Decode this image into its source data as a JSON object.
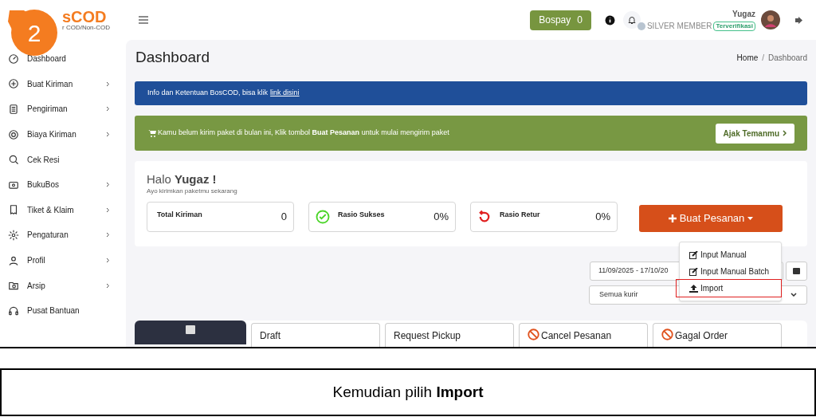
{
  "step_badge": "2",
  "logo": {
    "text": "sCOD",
    "tagline": "r COD/Non-COD"
  },
  "header": {
    "bospay": {
      "label": "Bospay",
      "value": "0"
    },
    "user": {
      "name": "Yugaz",
      "member": "SILVER MEMBER",
      "status": "Terverifikasi"
    }
  },
  "sidebar": {
    "items": [
      {
        "label": "Dashboard",
        "has_submenu": false
      },
      {
        "label": "Buat Kiriman",
        "has_submenu": true
      },
      {
        "label": "Pengiriman",
        "has_submenu": true
      },
      {
        "label": "Biaya Kiriman",
        "has_submenu": true
      },
      {
        "label": "Cek Resi",
        "has_submenu": false
      },
      {
        "label": "BukuBos",
        "has_submenu": true
      },
      {
        "label": "Tiket & Klaim",
        "has_submenu": true
      },
      {
        "label": "Pengaturan",
        "has_submenu": true
      },
      {
        "label": "Profil",
        "has_submenu": true
      },
      {
        "label": "Arsip",
        "has_submenu": true
      },
      {
        "label": "Pusat Bantuan",
        "has_submenu": false
      }
    ]
  },
  "page": {
    "title": "Dashboard",
    "breadcrumb": [
      "Home",
      "Dashboard"
    ],
    "breadcrumb_separator": "/"
  },
  "info_banner": {
    "text": "Info dan Ketentuan BosCOD, bisa klik",
    "link": "link disini"
  },
  "promo_banner": {
    "text": "Kamu belum kirim paket di bulan ini, Klik tombol **Buat Pesanan** untuk mulai mengirim paket",
    "button": "Ajak Temanmu"
  },
  "greeting": {
    "hello": "Halo",
    "name": "Yugaz !",
    "subtitle": "Ayo kirimkan paketmu sekarang"
  },
  "stats": [
    {
      "kind": "plain",
      "label": "Total Kiriman",
      "value": "0"
    },
    {
      "kind": "success",
      "label": "Rasio Sukses",
      "value": "0%"
    },
    {
      "kind": "return",
      "label": "Rasio Retur",
      "value": "0%"
    }
  ],
  "create_button": {
    "label": "Buat Pesanan",
    "items": [
      {
        "kind": "edit",
        "label": "Input Manual",
        "highlighted": false
      },
      {
        "kind": "edit",
        "label": "Input Manual Batch",
        "highlighted": false
      },
      {
        "kind": "upload",
        "label": "Import",
        "highlighted": true
      }
    ]
  },
  "filters": {
    "date_range": "11/09/2025 - 17/10/20",
    "courier": "Semua kurir"
  },
  "tabs": [
    {
      "kind": "icon",
      "selected": true
    },
    {
      "kind": "plain",
      "label": "Draft",
      "selected": false
    },
    {
      "kind": "plain",
      "label": "Request Pickup",
      "selected": false
    },
    {
      "kind": "cancel",
      "label": "Cancel Pesanan",
      "selected": false
    },
    {
      "kind": "cancel",
      "label": "Gagal Order",
      "selected": false
    }
  ],
  "caption": "Kemudian pilih **Import**"
}
